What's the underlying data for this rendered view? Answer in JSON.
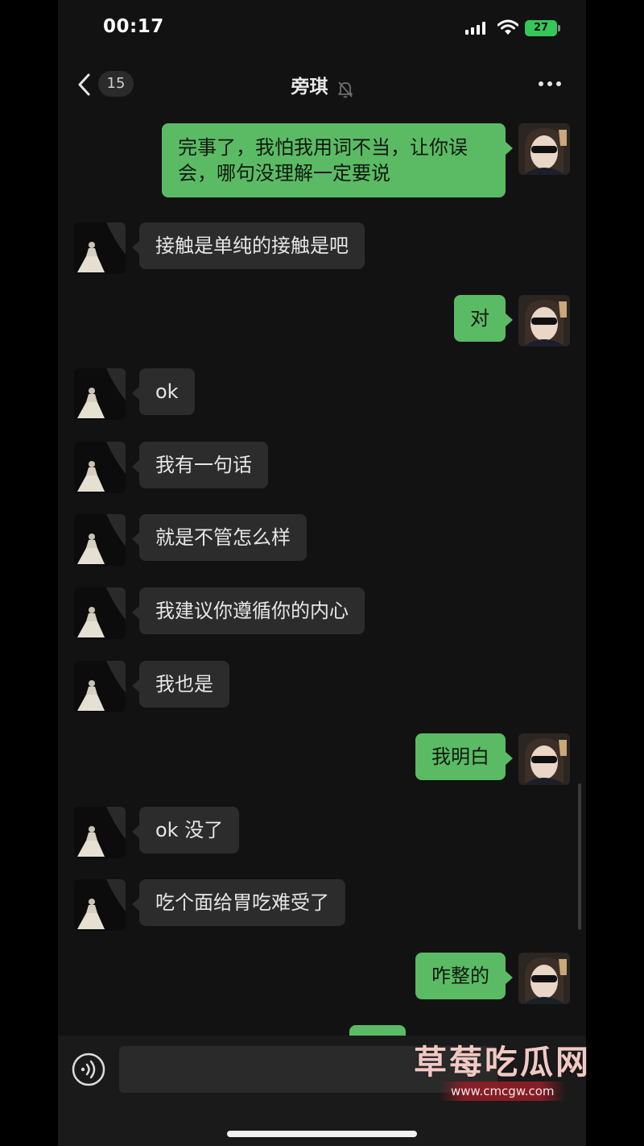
{
  "status_bar": {
    "time": "00:17",
    "battery": "27"
  },
  "nav": {
    "unread_count": "15",
    "title": "旁琪"
  },
  "messages": [
    {
      "side": "right",
      "text": "完事了，我怕我用词不当，让你误会，哪句没理解一定要说"
    },
    {
      "side": "left",
      "text": "接触是单纯的接触是吧"
    },
    {
      "side": "right",
      "text": "对"
    },
    {
      "side": "left",
      "text": "ok"
    },
    {
      "side": "left",
      "text": "我有一句话"
    },
    {
      "side": "left",
      "text": "就是不管怎么样"
    },
    {
      "side": "left",
      "text": "我建议你遵循你的内心"
    },
    {
      "side": "left",
      "text": "我也是"
    },
    {
      "side": "right",
      "text": "我明白"
    },
    {
      "side": "left",
      "text": "ok 没了"
    },
    {
      "side": "left",
      "text": "吃个面给胃吃难受了"
    },
    {
      "side": "right",
      "text": "咋整的"
    }
  ],
  "input": {
    "placeholder": ""
  },
  "watermark": {
    "title": "草莓吃瓜网",
    "url": "www.cmcgw.com"
  },
  "colors": {
    "sent_bubble": "#5bbb64",
    "received_bubble": "#2c2c2c",
    "background": "#121212",
    "battery": "#35c759"
  },
  "icons": {
    "back": "chevron-left-icon",
    "mute": "bell-slash-icon",
    "more": "more-dots-icon",
    "voice": "voice-icon"
  }
}
